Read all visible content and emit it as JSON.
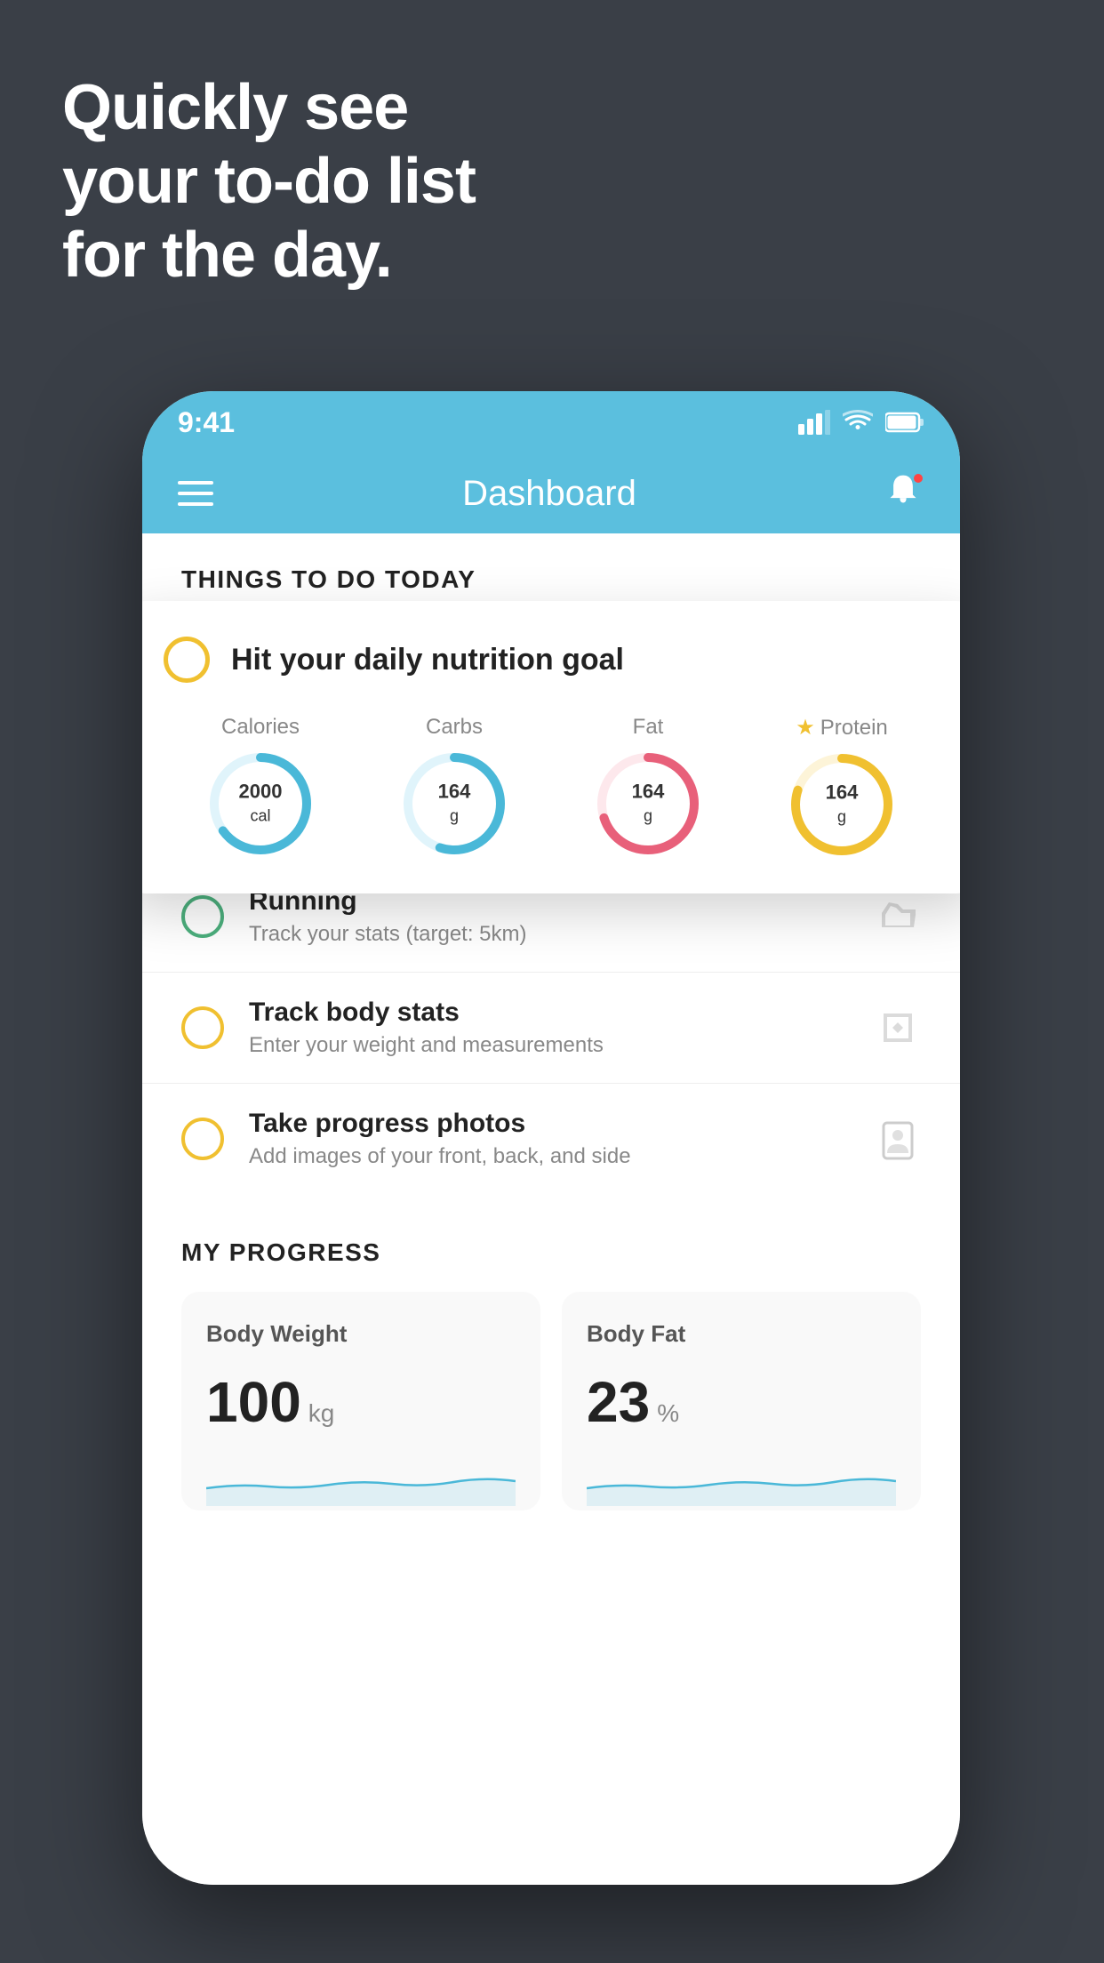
{
  "hero": {
    "line1": "Quickly see",
    "line2": "your to-do list",
    "line3": "for the day."
  },
  "status_bar": {
    "time": "9:41"
  },
  "nav": {
    "title": "Dashboard"
  },
  "section": {
    "things_today": "THINGS TO DO TODAY"
  },
  "nutrition_card": {
    "check_circle_color": "#f0c030",
    "title": "Hit your daily nutrition goal",
    "items": [
      {
        "label": "Calories",
        "value": "2000",
        "unit": "cal",
        "color": "#4ab8d8",
        "track_color": "#e0f4fb",
        "percent": 65
      },
      {
        "label": "Carbs",
        "value": "164",
        "unit": "g",
        "color": "#4ab8d8",
        "track_color": "#e0f4fb",
        "percent": 55
      },
      {
        "label": "Fat",
        "value": "164",
        "unit": "g",
        "color": "#e8607a",
        "track_color": "#fde8ec",
        "percent": 70
      },
      {
        "label": "Protein",
        "value": "164",
        "unit": "g",
        "color": "#f0c030",
        "track_color": "#fdf4d8",
        "percent": 80,
        "starred": true
      }
    ]
  },
  "todo_items": [
    {
      "id": "running",
      "circle_type": "green",
      "title": "Running",
      "subtitle": "Track your stats (target: 5km)",
      "icon": "shoe"
    },
    {
      "id": "body-stats",
      "circle_type": "yellow",
      "title": "Track body stats",
      "subtitle": "Enter your weight and measurements",
      "icon": "scale"
    },
    {
      "id": "progress-photos",
      "circle_type": "yellow",
      "title": "Take progress photos",
      "subtitle": "Add images of your front, back, and side",
      "icon": "portrait"
    }
  ],
  "progress": {
    "section_title": "MY PROGRESS",
    "cards": [
      {
        "title": "Body Weight",
        "value": "100",
        "unit": "kg"
      },
      {
        "title": "Body Fat",
        "value": "23",
        "unit": "%"
      }
    ]
  }
}
